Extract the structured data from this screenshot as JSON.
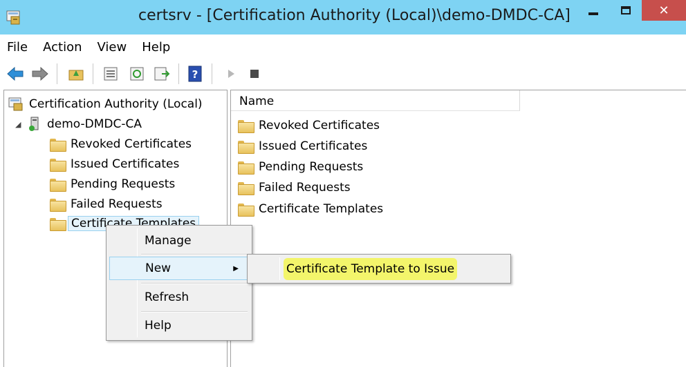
{
  "window": {
    "title": "certsrv - [Certification Authority (Local)\\demo-DMDC-CA]",
    "close_glyph": "✕"
  },
  "menubar": [
    "File",
    "Action",
    "View",
    "Help"
  ],
  "toolbar": {
    "icons": [
      "back-arrow-icon",
      "forward-arrow-icon",
      "up-folder-icon",
      "properties-icon",
      "refresh-icon",
      "export-list-icon",
      "help-icon",
      "start-service-icon",
      "stop-service-icon"
    ],
    "colors": {
      "nav_arrow": "#2e8fd8",
      "help_book": "#2a4fb0"
    }
  },
  "tree": {
    "root": "Certification Authority (Local)",
    "ca": "demo-DMDC-CA",
    "expander_glyph": "◢",
    "folders": [
      "Revoked Certificates",
      "Issued Certificates",
      "Pending Requests",
      "Failed Requests",
      "Certificate Templates"
    ]
  },
  "list": {
    "column_header": "Name",
    "items": [
      "Revoked Certificates",
      "Issued Certificates",
      "Pending Requests",
      "Failed Requests",
      "Certificate Templates"
    ]
  },
  "context_menu": {
    "items": [
      "Manage",
      "New",
      "Refresh",
      "Help"
    ],
    "submenu_arrow": "▶",
    "submenu": {
      "item": "Certificate Template to Issue",
      "highlight_color": "#f3f56b"
    }
  },
  "colors": {
    "titlebar": "#7ed3f3",
    "close_button": "#c74f4c",
    "selection_fill": "#e5f3fb",
    "selection_border": "#99d1ef"
  }
}
